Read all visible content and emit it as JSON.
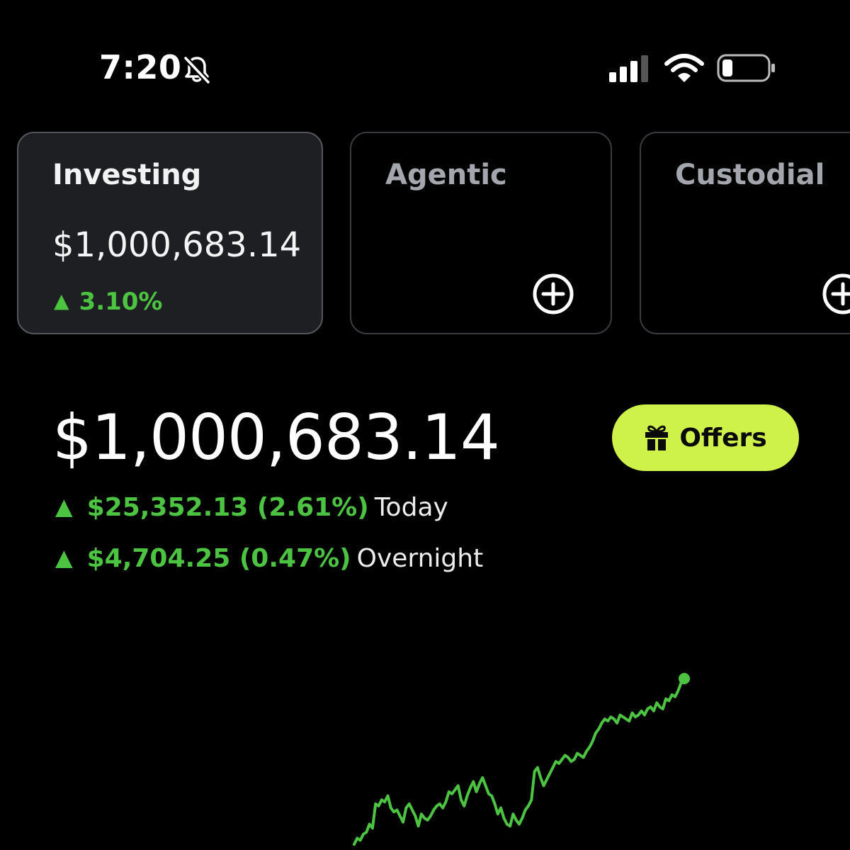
{
  "status_bar": {
    "time": "7:20",
    "icons": [
      "bell-slash-icon",
      "signal-icon",
      "wifi-icon",
      "battery-icon"
    ]
  },
  "accounts": [
    {
      "title": "Investing",
      "value": "$1,000,683.14",
      "change": "3.10%",
      "selected": true
    },
    {
      "title": "Agentic",
      "icon": "plus-circle-icon"
    },
    {
      "title": "Custodial",
      "icon": "plus-circle-icon"
    }
  ],
  "portfolio": {
    "value": "$1,000,683.14",
    "today": {
      "amount": "$25,352.13 (2.61%)",
      "label": "Today"
    },
    "overnight": {
      "amount": "$4,704.25 (0.47%)",
      "label": "Overnight"
    }
  },
  "offers_button": {
    "label": "Offers",
    "icon": "gift-icon"
  },
  "colors": {
    "accent_green": "#4cc442",
    "offers_bg": "#cff24a",
    "card_bg": "#1e1f23"
  },
  "chart_data": {
    "type": "line",
    "values": [
      0,
      3,
      2,
      5,
      6,
      10,
      8,
      20,
      19,
      22,
      21,
      24,
      18,
      16,
      17,
      14,
      11,
      18,
      20,
      17,
      14,
      9,
      15,
      13,
      12,
      14,
      17,
      19,
      20,
      18,
      21,
      26,
      25,
      27,
      29,
      22,
      19,
      24,
      28,
      31,
      26,
      30,
      33,
      29,
      25,
      24,
      20,
      15,
      18,
      13,
      10,
      9,
      15,
      12,
      10,
      13,
      17,
      19,
      22,
      36,
      38,
      33,
      29,
      32,
      35,
      38,
      41,
      40,
      42,
      44,
      43,
      41,
      42,
      45,
      44,
      43,
      46,
      48,
      51,
      55,
      57,
      60,
      62,
      61,
      63,
      62,
      60,
      64,
      63,
      62,
      61,
      65,
      63,
      64,
      66,
      64,
      67,
      68,
      66,
      70,
      68,
      67,
      72,
      71,
      74,
      73,
      76,
      80,
      82
    ]
  }
}
